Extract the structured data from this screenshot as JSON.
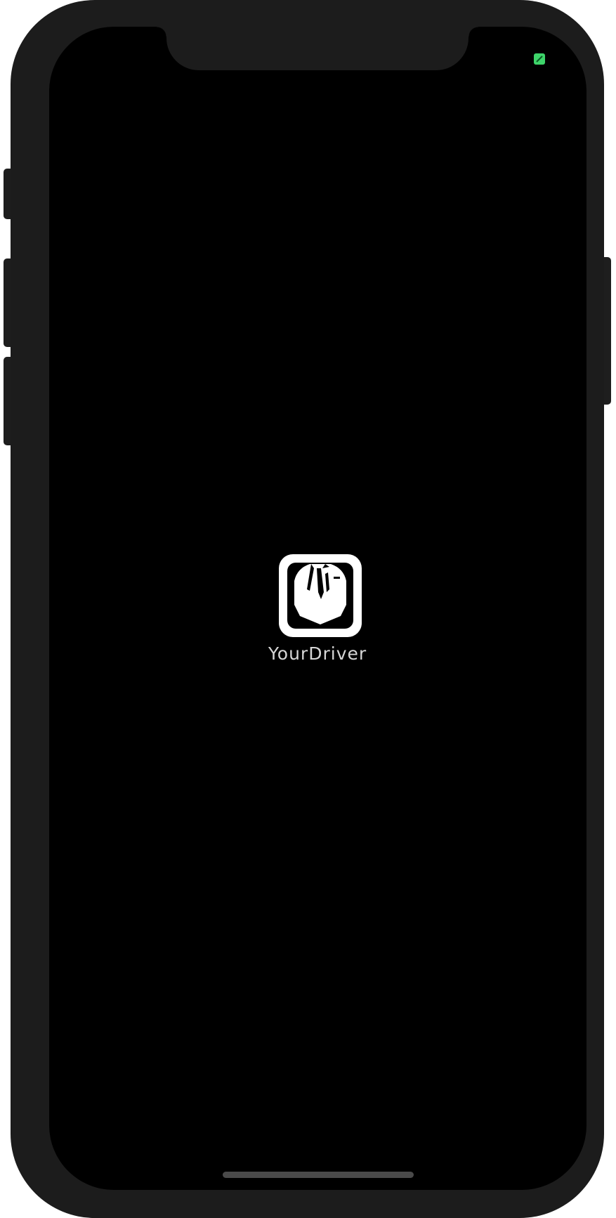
{
  "device": {
    "model": "iphone-x-style-frame",
    "frame_color": "#1c1c1c",
    "screen_color": "#000000"
  },
  "status_bar": {
    "indicator_icon": "green-status-icon",
    "indicator_color": "#3ed46a"
  },
  "splash": {
    "logo_icon": "yourdriver-logo-icon",
    "logo_color": "#ffffff",
    "app_name": "YourDriver",
    "app_name_color": "#d6d6d6"
  },
  "home_indicator": {
    "color": "#4a4a4a"
  }
}
